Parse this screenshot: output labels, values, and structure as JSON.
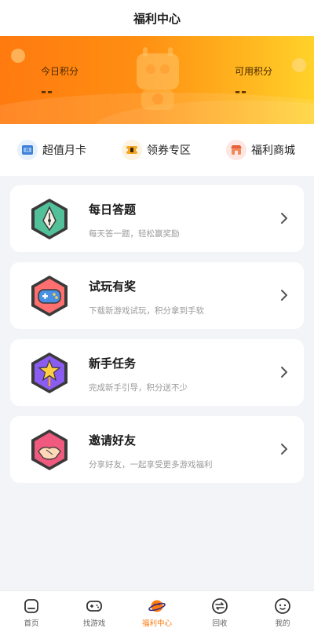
{
  "header": {
    "title": "福利中心"
  },
  "banner": {
    "today_label": "今日积分",
    "today_value": "--",
    "available_label": "可用积分",
    "available_value": "--"
  },
  "quick_links": [
    {
      "label": "超值月卡",
      "icon": "month-card-icon"
    },
    {
      "label": "领券专区",
      "icon": "coupon-icon"
    },
    {
      "label": "福利商城",
      "icon": "shop-icon"
    }
  ],
  "tasks": [
    {
      "title": "每日答题",
      "subtitle": "每天答一题，轻松赢奖励",
      "icon": "pen-nib-icon"
    },
    {
      "title": "试玩有奖",
      "subtitle": "下载新游戏试玩，积分拿到手软",
      "icon": "gamepad-icon"
    },
    {
      "title": "新手任务",
      "subtitle": "完成新手引导，积分送不少",
      "icon": "star-wand-icon"
    },
    {
      "title": "邀请好友",
      "subtitle": "分享好友，一起享受更多游戏福利",
      "icon": "handshake-icon"
    }
  ],
  "tabbar": [
    {
      "label": "首页",
      "icon": "home-icon",
      "active": false
    },
    {
      "label": "找游戏",
      "icon": "gamepad-icon",
      "active": false
    },
    {
      "label": "福利中心",
      "icon": "planet-icon",
      "active": true
    },
    {
      "label": "回收",
      "icon": "exchange-icon",
      "active": false
    },
    {
      "label": "我的",
      "icon": "profile-icon",
      "active": false
    }
  ],
  "colors": {
    "accent": "#ff7a0f",
    "banner_end": "#ffd22a",
    "background": "#f2f4f8"
  }
}
